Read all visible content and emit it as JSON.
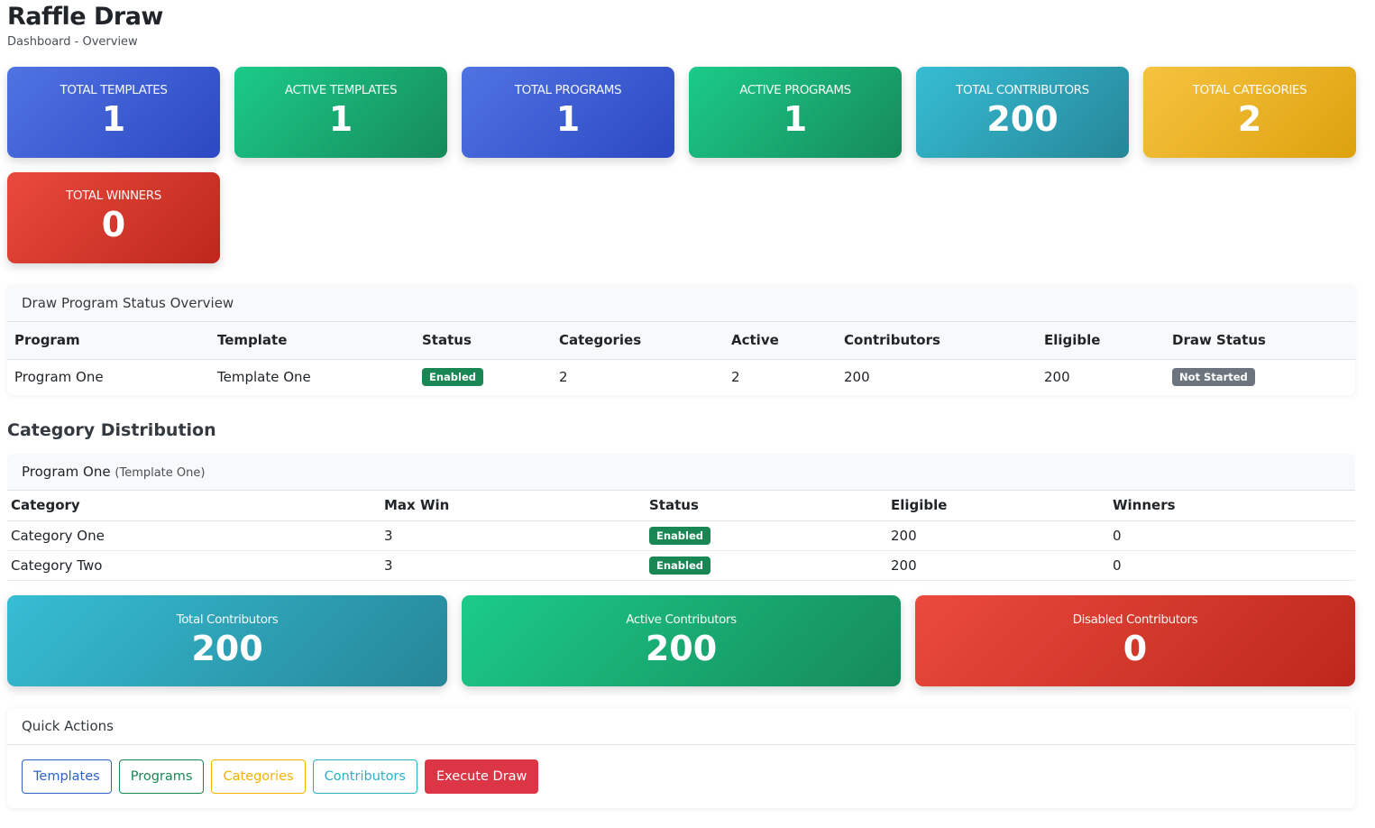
{
  "page": {
    "title": "Raffle Draw",
    "breadcrumb": "Dashboard - Overview"
  },
  "stats": [
    {
      "label": "TOTAL TEMPLATES",
      "value": "1",
      "color": "#3b5bdb"
    },
    {
      "label": "ACTIVE TEMPLATES",
      "value": "1",
      "color": "#17a673"
    },
    {
      "label": "TOTAL PROGRAMS",
      "value": "1",
      "color": "#3b5bdb"
    },
    {
      "label": "ACTIVE PROGRAMS",
      "value": "1",
      "color": "#17a673"
    },
    {
      "label": "TOTAL CONTRIBUTORS",
      "value": "200",
      "color": "#2ea7bd"
    },
    {
      "label": "TOTAL CATEGORIES",
      "value": "2",
      "color": "#eab025"
    },
    {
      "label": "TOTAL WINNERS",
      "value": "0",
      "color": "#d73a2e"
    }
  ],
  "program_status": {
    "header": "Draw Program Status Overview",
    "columns": [
      "Program",
      "Template",
      "Status",
      "Categories",
      "Active",
      "Contributors",
      "Eligible",
      "Draw Status"
    ],
    "rows": [
      {
        "program": "Program One",
        "template": "Template One",
        "status": "Enabled",
        "categories": "2",
        "active": "2",
        "contributors": "200",
        "eligible": "200",
        "draw_status": "Not Started"
      }
    ]
  },
  "category_distribution": {
    "title": "Category Distribution",
    "program_name": "Program One",
    "template_name": "(Template One)",
    "columns": [
      "Category",
      "Max Win",
      "Status",
      "Eligible",
      "Winners"
    ],
    "rows": [
      {
        "category": "Category One",
        "max_win": "3",
        "status": "Enabled",
        "eligible": "200",
        "winners": "0"
      },
      {
        "category": "Category Two",
        "max_win": "3",
        "status": "Enabled",
        "eligible": "200",
        "winners": "0"
      }
    ]
  },
  "contributors": [
    {
      "label": "Total Contributors",
      "value": "200",
      "color": "#2ea7bd"
    },
    {
      "label": "Active Contributors",
      "value": "200",
      "color": "#17a673"
    },
    {
      "label": "Disabled Contributors",
      "value": "0",
      "color": "#d73a2e"
    }
  ],
  "quick_actions": {
    "header": "Quick Actions",
    "buttons": [
      "Templates",
      "Programs",
      "Categories",
      "Contributors",
      "Execute Draw"
    ]
  }
}
